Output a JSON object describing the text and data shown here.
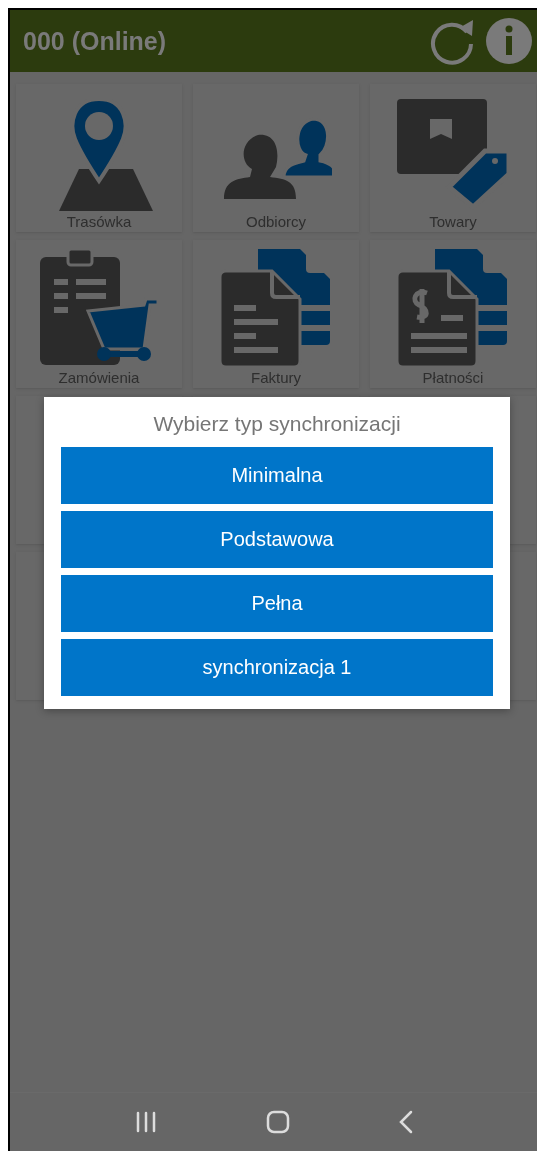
{
  "header": {
    "title": "000 (Online)"
  },
  "tiles": [
    {
      "label": "Trasówka",
      "kind": "route"
    },
    {
      "label": "Odbiorcy",
      "kind": "people"
    },
    {
      "label": "Towary",
      "kind": "goods"
    },
    {
      "label": "Zamówienia",
      "kind": "orders"
    },
    {
      "label": "Faktury",
      "kind": "invoices"
    },
    {
      "label": "Płatności",
      "kind": "payments"
    }
  ],
  "dialog": {
    "title": "Wybierz typ synchronizacji",
    "options": [
      "Minimalna",
      "Podstawowa",
      "Pełna",
      "synchronizacja 1"
    ]
  }
}
